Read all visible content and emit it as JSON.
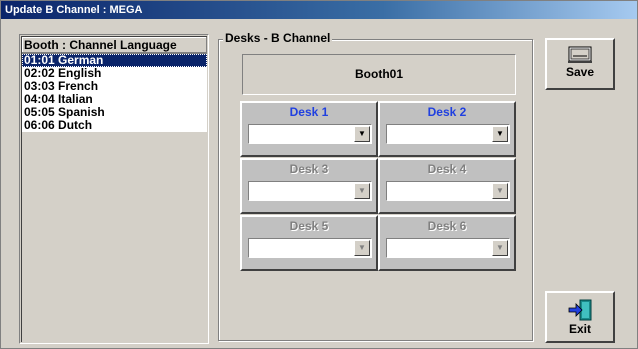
{
  "window": {
    "title": "Update B Channel : MEGA"
  },
  "list": {
    "header": "Booth : Channel Language",
    "items": [
      {
        "label": "01:01 German",
        "selected": true
      },
      {
        "label": "02:02 English",
        "selected": false
      },
      {
        "label": "03:03 French",
        "selected": false
      },
      {
        "label": "04:04 Italian",
        "selected": false
      },
      {
        "label": "05:05 Spanish",
        "selected": false
      },
      {
        "label": "06:06 Dutch",
        "selected": false
      }
    ]
  },
  "group": {
    "legend": "Desks - B Channel",
    "booth": "Booth01",
    "desks": [
      {
        "label": "Desk 1",
        "enabled": true,
        "value": ""
      },
      {
        "label": "Desk 2",
        "enabled": true,
        "value": ""
      },
      {
        "label": "Desk 3",
        "enabled": false,
        "value": ""
      },
      {
        "label": "Desk 4",
        "enabled": false,
        "value": ""
      },
      {
        "label": "Desk 5",
        "enabled": false,
        "value": ""
      },
      {
        "label": "Desk 6",
        "enabled": false,
        "value": ""
      }
    ]
  },
  "buttons": {
    "save": "Save",
    "exit": "Exit"
  },
  "icons": {
    "save": "keyboard-icon",
    "exit": "exit-door-icon",
    "dropdown": "dropdown-arrow-icon"
  },
  "colors": {
    "titlebar": "#0a246a",
    "selection": "#0a246a",
    "desk_active_label": "#2040e0",
    "face": "#d4d0c8"
  }
}
